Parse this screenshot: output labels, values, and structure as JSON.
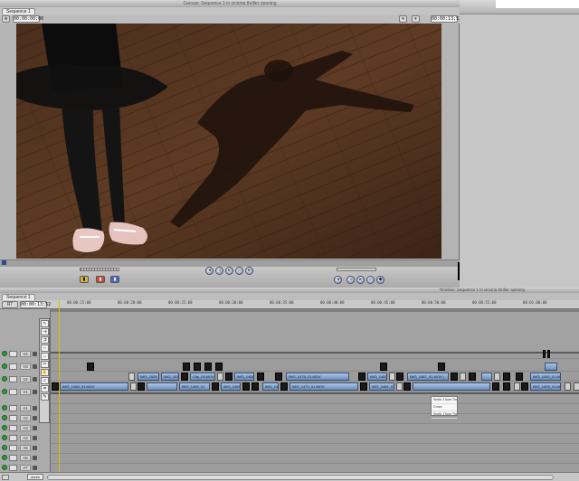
{
  "canvas": {
    "title": "Canvas: Sequence 1 in victoria thriller opening",
    "tab": "Sequence 1",
    "timecode_left": "00:00:00;00",
    "timecode_right": "00:00:13;52"
  },
  "timeline": {
    "title": "Timeline: Sequence 1 in victoria thriller opening",
    "tab": "Sequence 1",
    "rt_label": "RT",
    "current_timecode": "00:00:13;52",
    "ruler_ticks": [
      "00:00:15;00",
      "00:00:20;00",
      "00:00:25;00",
      "00:00:30;00",
      "00:00:35;00",
      "00:00:40;00",
      "00:00:45;00",
      "00:00:50;00",
      "00:00:55;00",
      "00:01:00;00"
    ],
    "tracks": [
      "V4",
      "V3",
      "V2",
      "V1",
      "A1",
      "A2",
      "A3",
      "A4",
      "A5",
      "A6",
      "A7",
      "A8"
    ],
    "clips_v2": [
      "IMG_1526",
      "IMG_1532",
      "Clip_05.MOV",
      "IMG_1488",
      "IMG_1475_01.MOV",
      "IMG_1483",
      "IMG_1487_01.MOV (",
      "IMG_1492_01.M"
    ],
    "clips_v1": [
      "IMG_1468_01.MOV",
      "IMG_1465_01",
      "IMG_1469",
      "IMG_1471",
      "IMG_1473_01.MOV",
      "IMG_1481_01",
      "IMG_1493_01.MO"
    ],
    "popup_items": [
      "Smith 1Tone Thr.",
      "Cross",
      "Smith 1Tone Thr."
    ],
    "bottom_label": "zoom"
  },
  "colors": {
    "clip": "#8aaad4",
    "track_dot": "#2f9a3a",
    "playhead": "#d6c200"
  },
  "icons": [
    "selection-tool-icon",
    "razor-icon",
    "play-icon",
    "mark-in-icon",
    "mark-out-icon"
  ]
}
